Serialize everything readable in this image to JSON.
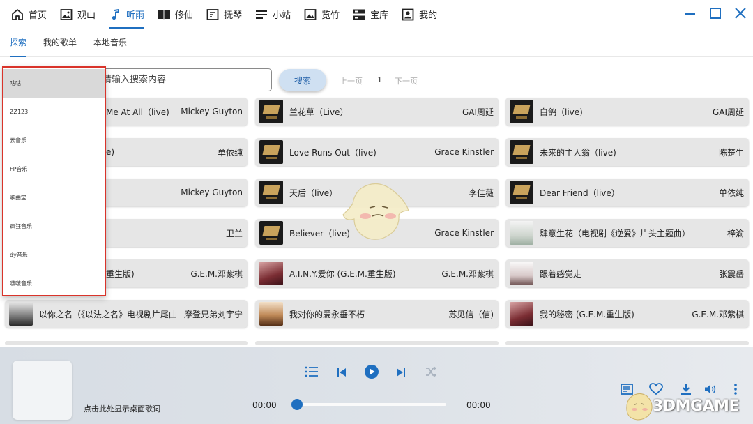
{
  "nav": {
    "items": [
      {
        "label": "首页",
        "icon": "home-icon"
      },
      {
        "label": "观山",
        "icon": "image-frame-icon"
      },
      {
        "label": "听雨",
        "icon": "music-note-icon",
        "active": true
      },
      {
        "label": "修仙",
        "icon": "book-icon"
      },
      {
        "label": "抚琴",
        "icon": "edit-box-icon"
      },
      {
        "label": "小站",
        "icon": "menu-lines-icon"
      },
      {
        "label": "览竹",
        "icon": "photo-icon"
      },
      {
        "label": "宝库",
        "icon": "storage-icon"
      },
      {
        "label": "我的",
        "icon": "profile-icon"
      }
    ]
  },
  "subtabs": [
    {
      "label": "探索",
      "active": true
    },
    {
      "label": "我的歌单"
    },
    {
      "label": "本地音乐"
    }
  ],
  "search": {
    "placeholder": "请输入搜索内容",
    "button": "搜索",
    "prev": "上一页",
    "page": "1",
    "next": "下一页"
  },
  "songs": [
    {
      "title": "Me At All（live)",
      "artist": "Mickey Guyton"
    },
    {
      "title": "兰花草（Live）",
      "artist": "GAI周延"
    },
    {
      "title": "白鸽（live)",
      "artist": "GAI周延"
    },
    {
      "title": "e)",
      "artist": "单依纯"
    },
    {
      "title": "Love Runs Out（live)",
      "artist": "Grace Kinstler"
    },
    {
      "title": "未来的主人翁（live)",
      "artist": "陈楚生"
    },
    {
      "title": "",
      "artist": "Mickey Guyton"
    },
    {
      "title": "天后（live）",
      "artist": "李佳薇"
    },
    {
      "title": "Dear Friend（live）",
      "artist": "单依纯"
    },
    {
      "title": "",
      "artist": "卫兰"
    },
    {
      "title": "Believer（live)",
      "artist": "Grace Kinstler"
    },
    {
      "title": "肆意生花（电视剧《逆爱》片头主题曲）",
      "artist": "梓渝"
    },
    {
      "title": "重生版)",
      "artist": "G.E.M.邓紫棋"
    },
    {
      "title": "A.I.N.Y.爱你 (G.E.M.重生版)",
      "artist": "G.E.M.邓紫棋"
    },
    {
      "title": "跟着感觉走",
      "artist": "张震岳"
    },
    {
      "title": "以你之名（《以法之名》电视剧片尾曲",
      "artist": "摩登兄弟刘宇宁"
    },
    {
      "title": "我对你的爱永垂不朽",
      "artist": "苏见信（信)"
    },
    {
      "title": "我的秘密 (G.E.M.重生版)",
      "artist": "G.E.M.邓紫棋"
    }
  ],
  "sources": {
    "selected": "咕咕",
    "items": [
      "咕咕",
      "ZZ123",
      "云音乐",
      "FP音乐",
      "歌曲宝",
      "疯狂音乐",
      "dy音乐",
      "啵啵音乐"
    ]
  },
  "player": {
    "lyric_hint": "点击此处显示桌面歌词",
    "current_time": "00:00",
    "total_time": "00:00",
    "progress": 0
  },
  "watermark": "3DMGAME",
  "colors": {
    "accent": "#1f6fc0",
    "highlight_border": "#d9342b",
    "search_button_bg": "#cfe0f2"
  }
}
